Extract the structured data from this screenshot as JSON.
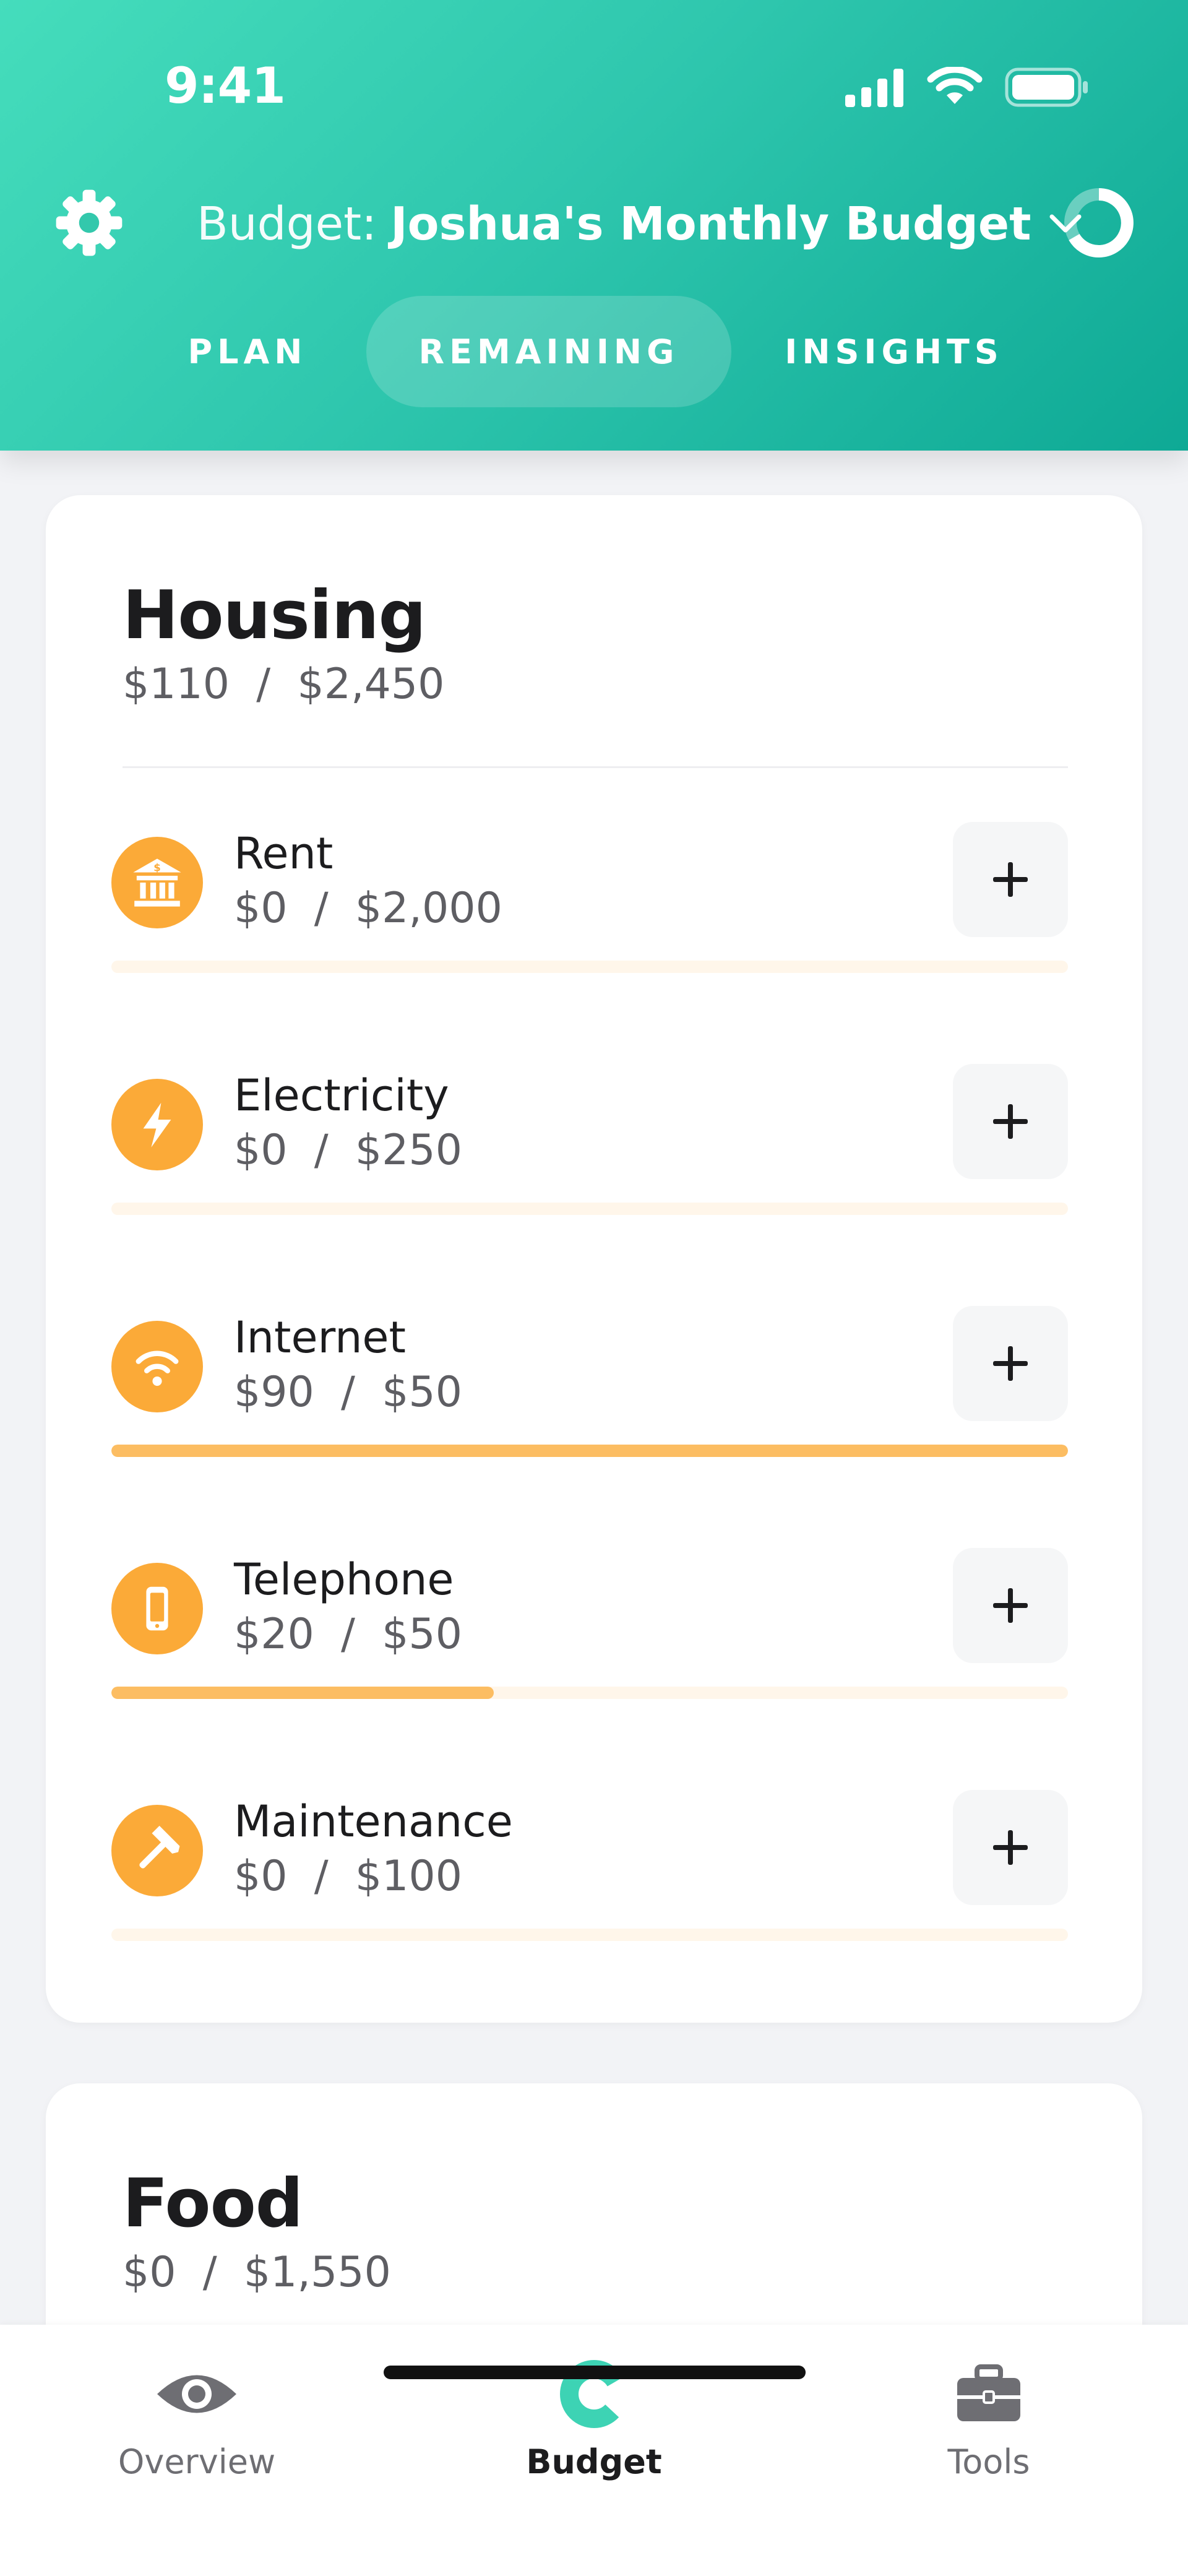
{
  "status_bar": {
    "time": "9:41"
  },
  "header": {
    "budget_prefix": "Budget:",
    "budget_name": "Joshua's Monthly Budget",
    "icons": {
      "settings": "gear-icon",
      "dropdown": "chevron-down-icon",
      "progress": "progress-ring-icon"
    },
    "tabs": [
      {
        "label": "PLAN",
        "active": false
      },
      {
        "label": "REMAINING",
        "active": true
      },
      {
        "label": "INSIGHTS",
        "active": false
      }
    ]
  },
  "colors": {
    "header_gradient_start": "#45DDBC",
    "header_gradient_end": "#0EA995",
    "accent_orange": "#FBAA38",
    "bar_fill": "#FCBD62",
    "bar_track": "#FFF6EA",
    "active_nav": "#3DD3B4"
  },
  "housing": {
    "title": "Housing",
    "amount": "$110  /  $2,450",
    "items": [
      {
        "name": "Rent",
        "amount": "$0  /  $2,000",
        "icon": "bank-icon",
        "progress": 0
      },
      {
        "name": "Electricity",
        "amount": "$0  /  $250",
        "icon": "lightning-icon",
        "progress": 0
      },
      {
        "name": "Internet",
        "amount": "$90  /  $50",
        "icon": "wifi-icon",
        "progress": 1
      },
      {
        "name": "Telephone",
        "amount": "$20  /  $50",
        "icon": "phone-icon",
        "progress": 0.4
      },
      {
        "name": "Maintenance",
        "amount": "$0  /  $100",
        "icon": "hammer-icon",
        "progress": 0
      }
    ]
  },
  "food": {
    "title": "Food",
    "amount": "$0  /  $1,550"
  },
  "bottom_nav": [
    {
      "label": "Overview",
      "icon": "eye-icon",
      "active": false
    },
    {
      "label": "Budget",
      "icon": "budget-ring-icon",
      "active": true
    },
    {
      "label": "Tools",
      "icon": "toolbox-icon",
      "active": false
    }
  ]
}
